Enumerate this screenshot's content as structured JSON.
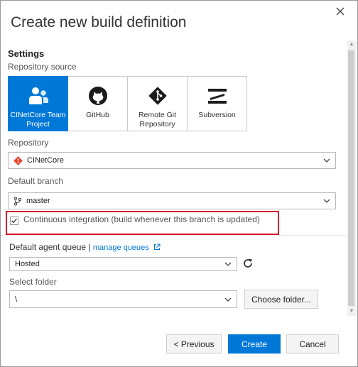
{
  "dialog": {
    "title": "Create new build definition"
  },
  "settings": {
    "heading": "Settings",
    "repository_source_label": "Repository source",
    "sources": [
      {
        "label": "CINetCore Team Project",
        "icon": "team-project-icon",
        "selected": true
      },
      {
        "label": "GitHub",
        "icon": "github-icon",
        "selected": false
      },
      {
        "label": "Remote Git Repository",
        "icon": "git-icon",
        "selected": false
      },
      {
        "label": "Subversion",
        "icon": "subversion-icon",
        "selected": false
      }
    ],
    "repository_label": "Repository",
    "repository_value": "CINetCore",
    "default_branch_label": "Default branch",
    "default_branch_value": "master",
    "ci_label": "Continuous integration (build whenever this branch is updated)",
    "ci_checked": true,
    "agent_queue_label": "Default agent queue |",
    "manage_queues_link": "manage queues",
    "agent_queue_value": "Hosted",
    "select_folder_label": "Select folder",
    "folder_value": "\\",
    "choose_folder_button": "Choose folder..."
  },
  "footer": {
    "previous_button": "< Previous",
    "create_button": "Create",
    "cancel_button": "Cancel"
  },
  "colors": {
    "accent": "#0078d7",
    "highlight": "#d9122a",
    "git": "#e8422d"
  }
}
